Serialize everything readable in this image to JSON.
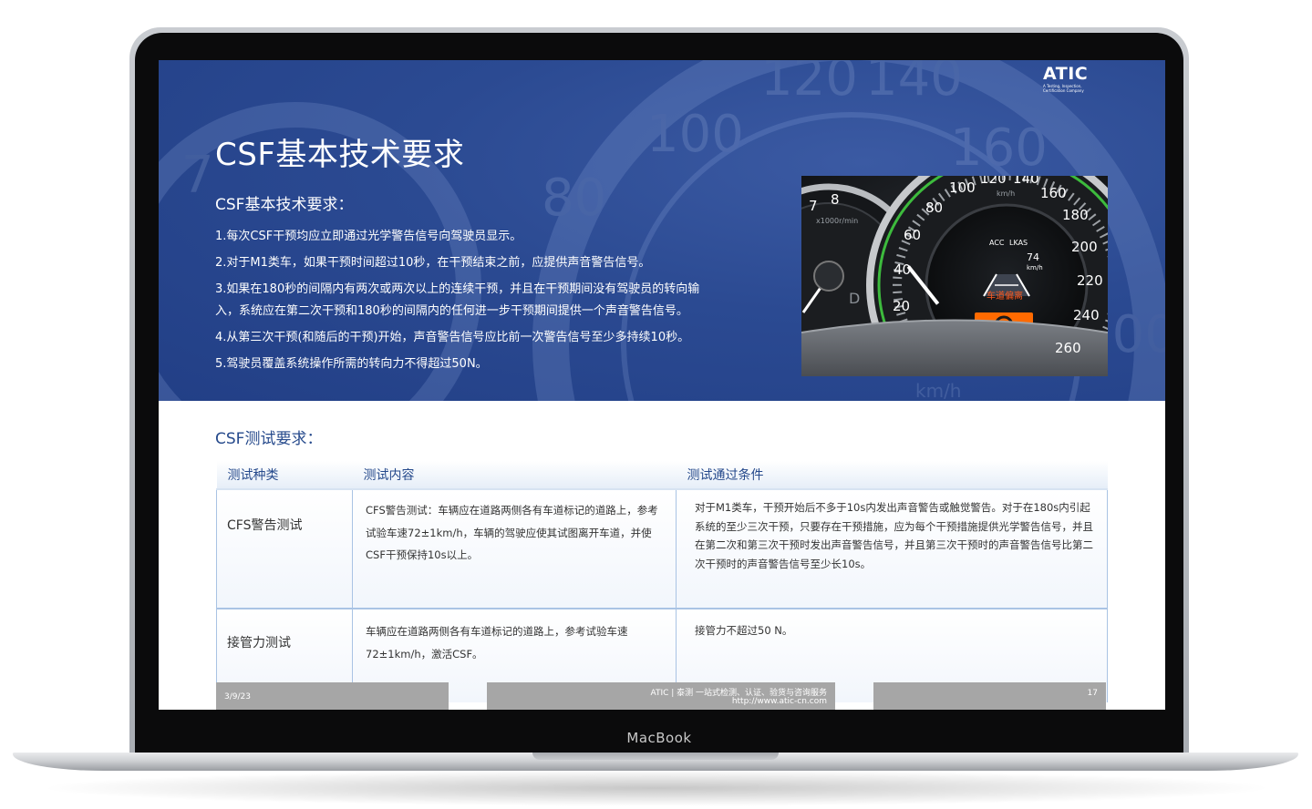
{
  "device": {
    "brand_label": "MacBook"
  },
  "slide": {
    "logo": {
      "text": "ATIC",
      "tagline": "A Testing, Inspection, Certification Company"
    },
    "title": "CSF基本技术要求",
    "requirements": {
      "heading": "CSF基本技术要求：",
      "items": [
        "1.每次CSF干预均应立即通过光学警告信号向驾驶员显示。",
        "2.对于M1类车，如果干预时间超过10秒，在干预结束之前，应提供声音警告信号。",
        "3.如果在180秒的间隔内有两次或两次以上的连续干预，并且在干预期间没有驾驶员的转向输入，系统应在第二次干预和180秒的间隔内的任何进一步干预期间提供一个声音警告信号。",
        "4.从第三次干预(和随后的干预)开始，声音警告信号应比前一次警告信号至少多持续10秒。",
        "5.驾驶员覆盖系统操作所需的转向力不得超过50N。"
      ]
    },
    "dashboard": {
      "speed_ticks": [
        "20",
        "40",
        "60",
        "80",
        "100",
        "120",
        "140",
        "160",
        "180",
        "200",
        "220",
        "240",
        "260"
      ],
      "speed_unit": "km/h",
      "rpm_ticks": [
        "7",
        "8"
      ],
      "rpm_unit": "x1000r/min",
      "gear": "D",
      "display_acc": "ACC",
      "display_lkas": "LKAS",
      "display_speed": "74",
      "display_speed_unit": "km/h",
      "display_warning": "车道偏离"
    },
    "test": {
      "heading": "CSF测试要求：",
      "columns": [
        "测试种类",
        "测试内容",
        "测试通过条件"
      ],
      "rows": [
        {
          "kind": "CFS警告测试",
          "content": "CFS警告测试：车辆应在道路两侧各有车道标记的道路上，参考试验车速72±1km/h，车辆的驾驶应使其试图离开车道，并使CSF干预保持10s以上。",
          "condition": "对于M1类车，干预开始后不多于10s内发出声音警告或触觉警告。对于在180s内引起系统的至少三次干预，只要存在干预措施，应为每个干预措施提供光学警告信号，并且在第二次和第三次干预时发出声音警告信号，并且第三次干预时的声音警告信号比第二次干预时的声音警告信号至少长10s。"
        },
        {
          "kind": "接管力测试",
          "content": "车辆应在道路两侧各有车道标记的道路上，参考试验车速72±1km/h，激活CSF。",
          "condition": "接管力不超过50 N。"
        }
      ]
    },
    "footer": {
      "date": "3/9/23",
      "company": "ATIC | 泰测 一站式检测、认证、验货与咨询服务",
      "url": "http://www.atic-cn.com",
      "page": "17"
    }
  },
  "colors": {
    "hero_blue": "#2b4a92",
    "heading_blue": "#264a8c",
    "footer_gray": "#a6a6a6",
    "warning_orange": "#ff6a00",
    "gauge_green": "#3dbb3d"
  }
}
